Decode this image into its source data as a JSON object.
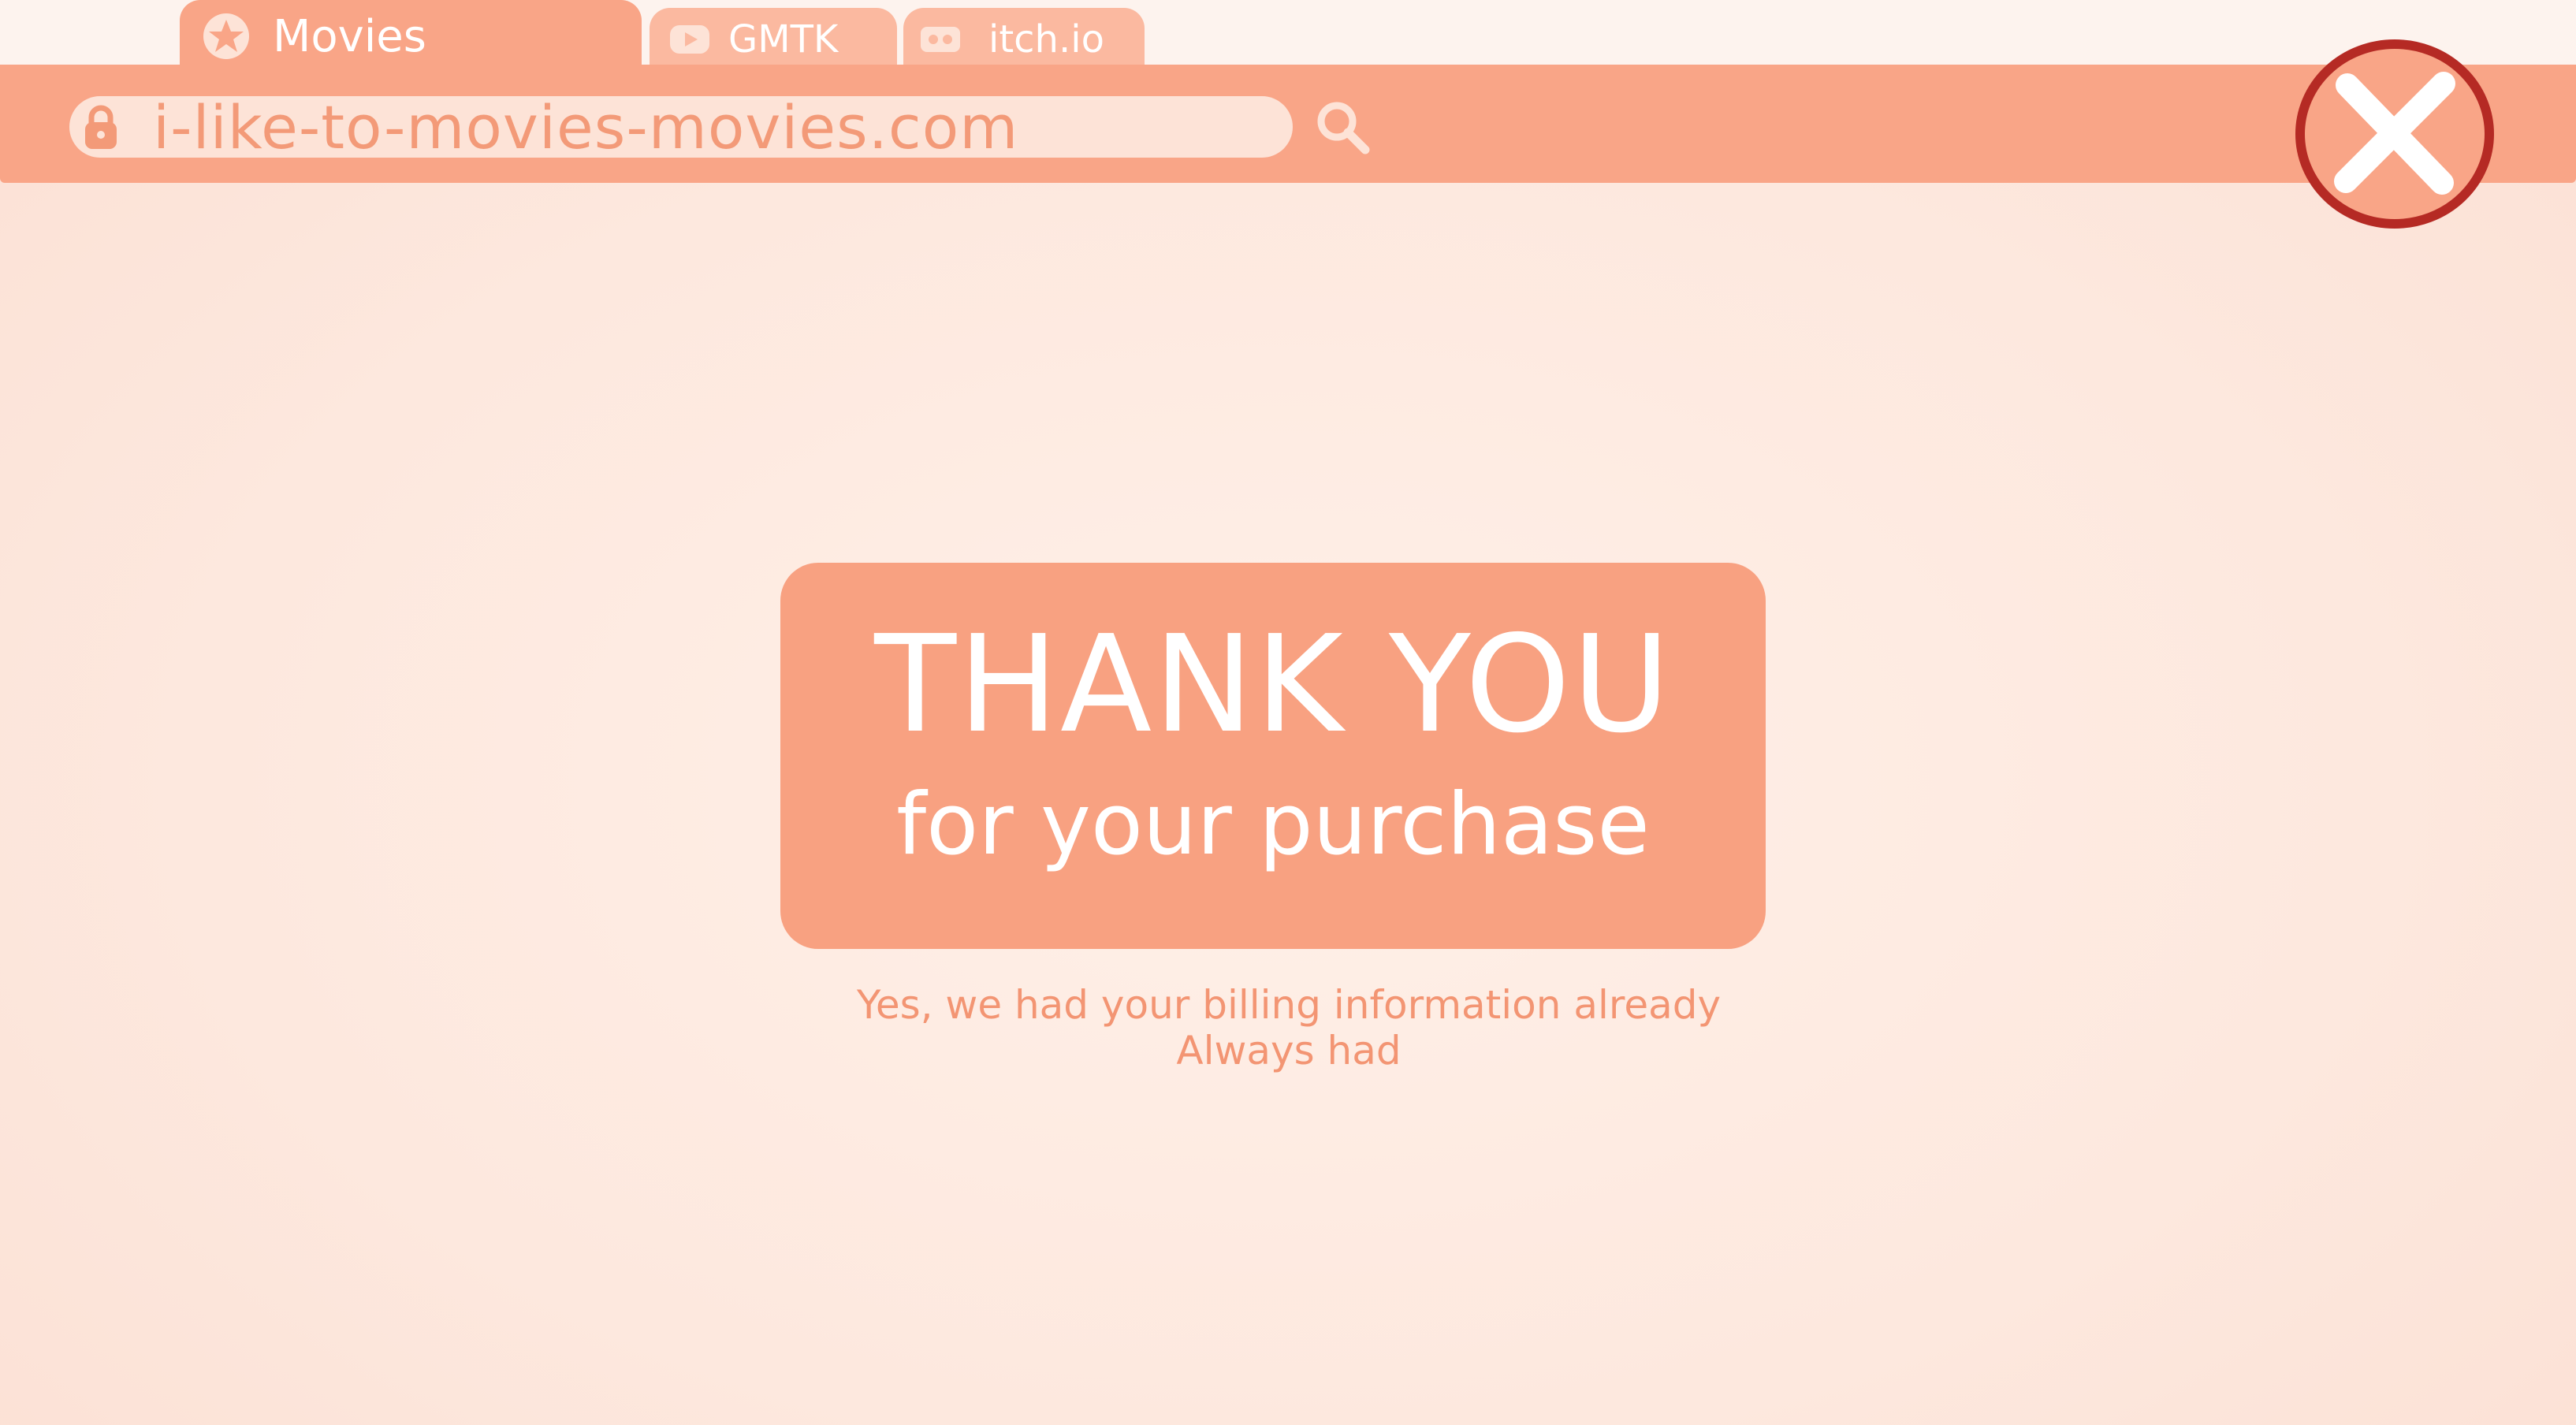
{
  "browser": {
    "tabs": [
      {
        "label": "Movies",
        "icon": "star-badge-icon",
        "active": true
      },
      {
        "label": "GMTK",
        "icon": "youtube-icon",
        "active": false
      },
      {
        "label": "itch.io",
        "icon": "itch-io-icon",
        "active": false
      }
    ],
    "address": {
      "url": "i-like-to-movies-movies.com",
      "lock_icon": "lock-icon",
      "search_icon": "search-icon"
    },
    "close_icon": "close-icon"
  },
  "page": {
    "title": "THANK YOU",
    "subtitle": "for your purchase",
    "note_line1": "Yes, we had your billing information already",
    "note_line2": "Always had"
  },
  "colors": {
    "background": "#fde9df",
    "accent": "#f9a587",
    "card": "#f8a181",
    "text_accent": "#f39573",
    "close_ring": "#b52a24"
  }
}
